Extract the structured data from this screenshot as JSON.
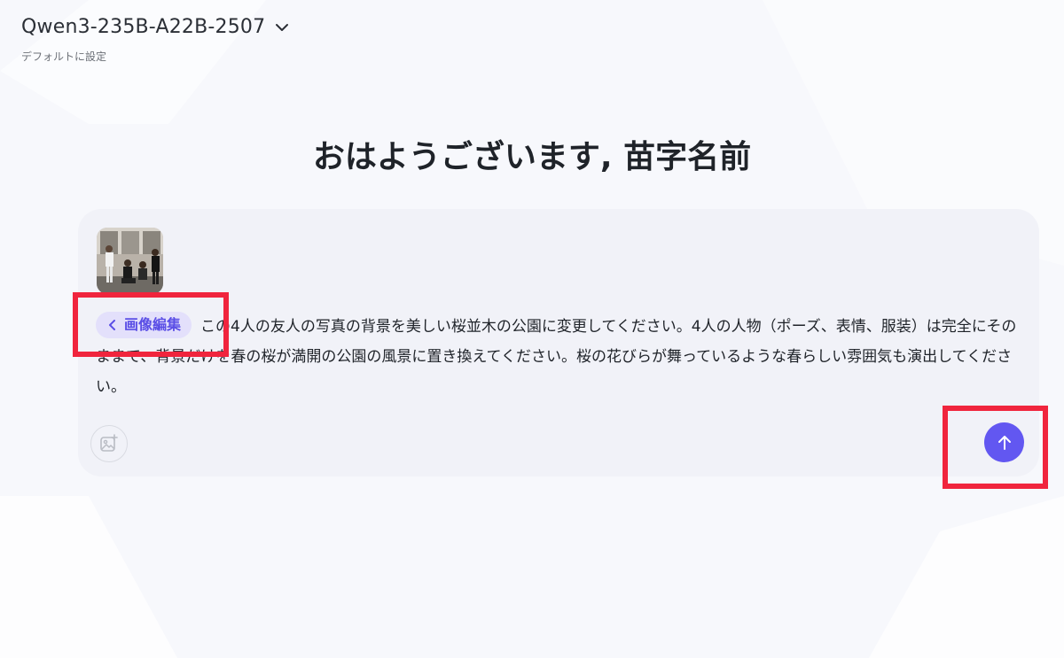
{
  "header": {
    "model_name": "Qwen3-235B-A22B-2507",
    "set_default_label": "デフォルトに設定"
  },
  "greeting": "おはようございます, 苗字名前",
  "composer": {
    "attachment_icon": "photo-thumbnail",
    "chip_label": "画像編集",
    "prompt_text": "この4人の友人の写真の背景を美しい桜並木の公園に変更してください。4人の人物（ポーズ、表情、服装）は完全にそのままで、背景だけを春の桜が満開の公園の風景に置き換えてください。桜の花びらが舞っているような春らしい雰囲気も演出してください。",
    "upload_icon": "image-plus-icon",
    "send_icon": "arrow-up-icon"
  },
  "colors": {
    "accent": "#6257f1",
    "chip_bg": "#e3e0fb",
    "annotation": "#f0253d",
    "composer_bg": "#f1f2f8"
  }
}
